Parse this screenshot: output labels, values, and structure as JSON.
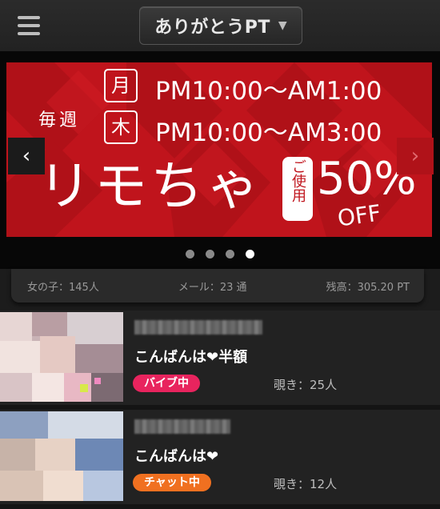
{
  "header": {
    "title": "ありがとうPT"
  },
  "banner": {
    "weekly": "毎週",
    "day1": "月",
    "time1": "PM10:00～AM1:00",
    "day2": "木",
    "time2": "PM10:00～AM3:00",
    "headline": "リモちゃ",
    "tag": "ご使用",
    "discount": "50%",
    "off": "OFF",
    "colors": {
      "banner_bg": "#c0141c"
    },
    "slides_total": 4,
    "active_slide": 4
  },
  "stats": {
    "girls": "女の子：145人",
    "mail": "メール：23 通",
    "balance": "残高：305.20 PT"
  },
  "items": [
    {
      "message": "こんばんは❤半額",
      "status": "バイブ中",
      "status_color": "#e8245e",
      "viewers": "覗き：25人"
    },
    {
      "message": "こんばんは❤",
      "status": "チャット中",
      "status_color": "#f07020",
      "viewers": "覗き：12人"
    }
  ]
}
